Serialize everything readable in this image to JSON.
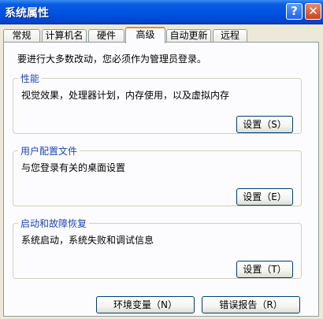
{
  "window": {
    "title": "系统属性",
    "help_button": "?",
    "close_button": "✕"
  },
  "tabs": [
    {
      "label": "常规",
      "active": false
    },
    {
      "label": "计算机名",
      "active": false
    },
    {
      "label": "硬件",
      "active": false
    },
    {
      "label": "高级",
      "active": true
    },
    {
      "label": "自动更新",
      "active": false
    },
    {
      "label": "远程",
      "active": false
    }
  ],
  "admin_note": "要进行大多数改动，您必须作为管理员登录。",
  "groups": [
    {
      "title": "性能",
      "description": "视觉效果，处理器计划，内存使用，以及虚拟内存",
      "button": "设置（S）"
    },
    {
      "title": "用户配置文件",
      "description": "与您登录有关的桌面设置",
      "button": "设置（E）"
    },
    {
      "title": "启动和故障恢复",
      "description": "系统启动，系统失败和调试信息",
      "button": "设置（T）"
    }
  ],
  "bottom_buttons": {
    "environment_variables": "环境变量（N）",
    "error_reporting": "错误报告（R）"
  }
}
